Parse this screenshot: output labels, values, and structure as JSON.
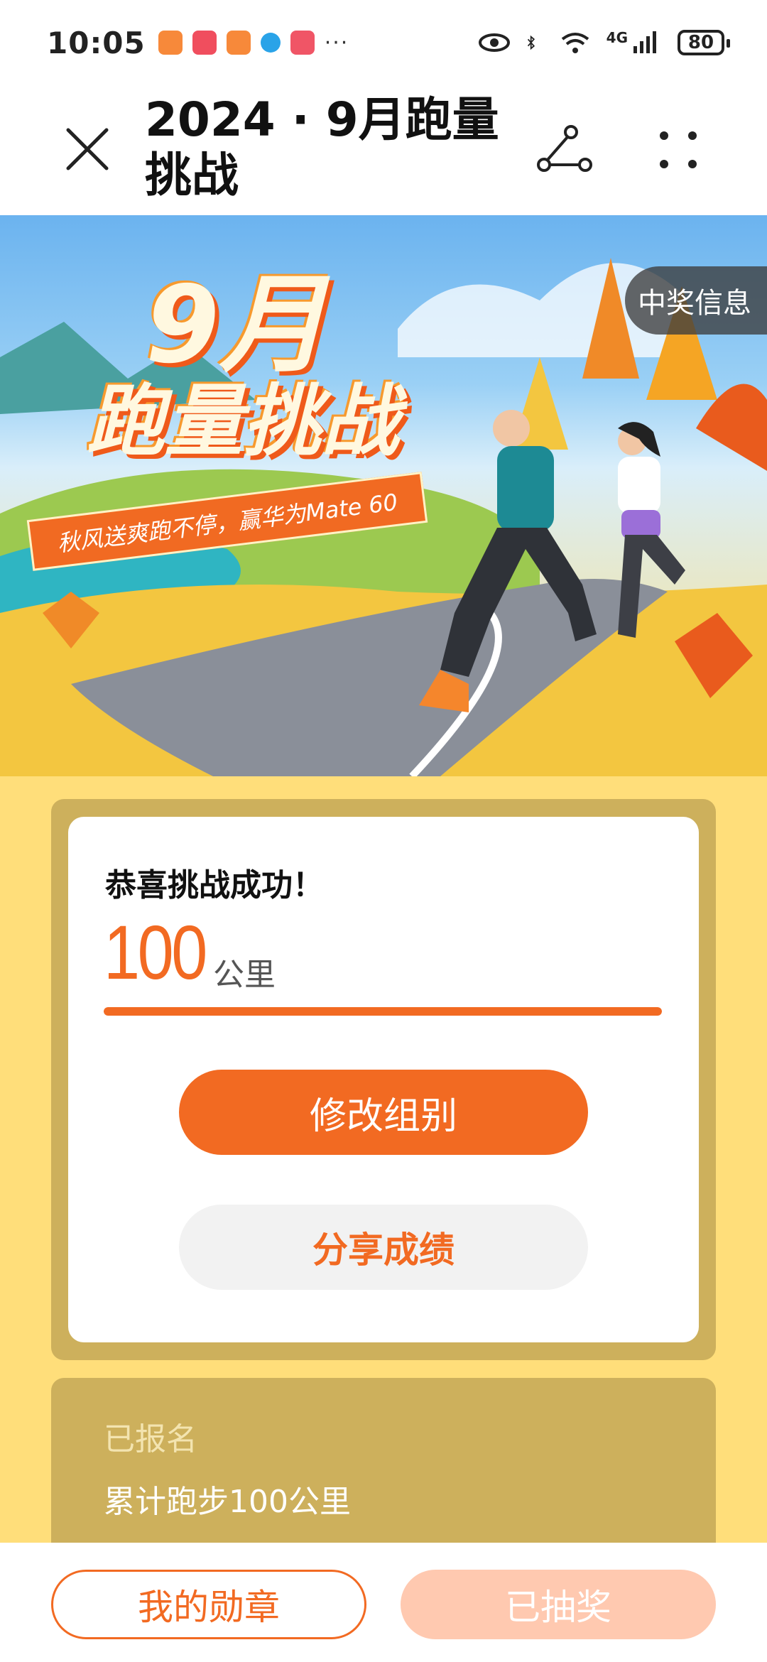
{
  "status_bar": {
    "time": "10:05",
    "more": "···",
    "network": "4G",
    "battery": "80",
    "icons": [
      "eye-icon",
      "bluetooth-icon",
      "wifi-icon",
      "signal-icon"
    ]
  },
  "header": {
    "title": "2024 · 9月跑量挑战",
    "close_icon": "close-icon",
    "share_icon": "share-icon",
    "menu_icon": "more-menu-icon"
  },
  "banner": {
    "award_info": "中奖信息",
    "title_line1": "9月",
    "title_line2": "跑量挑战",
    "subtitle": "秋风送爽跑不停，赢华为Mate 60"
  },
  "result_card": {
    "congrats": "恭喜挑战成功！",
    "distance": "100",
    "unit": "公里",
    "progress": 1.0,
    "change_group_label": "修改组别",
    "share_label": "分享成绩"
  },
  "info_card": {
    "status": "已报名",
    "goal": "累计跑步100公里"
  },
  "bottom": {
    "medals_label": "我的勋章",
    "drawn_label": "已抽奖"
  },
  "colors": {
    "accent": "#f26a22",
    "background": "#ffde7a",
    "frame": "#cdb05c",
    "disabled": "#ffc9b0"
  }
}
